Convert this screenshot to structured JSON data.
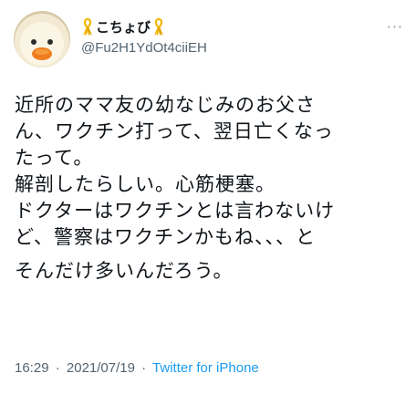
{
  "user": {
    "display_name": "こちょび",
    "handle": "@Fu2H1YdOt4ciiEH",
    "badge_icon": "yellow-ribbon-icon",
    "avatar_icon": "duck-avatar-icon"
  },
  "menu": {
    "more_label": "···"
  },
  "tweet": {
    "lines": [
      "近所のママ友の幼なじみのお父さ",
      "ん、ワクチン打って、翌日亡くなっ",
      "たって。",
      "解剖したらしい。心筋梗塞。",
      "ドクターはワクチンとは言わないけ",
      "ど、警察はワクチンかもね、、、と",
      "そんだけ多いんだろう。"
    ],
    "time": "16:29",
    "date": "2021/07/19",
    "separator": "·",
    "source": "Twitter for iPhone"
  },
  "colors": {
    "text": "#0f1419",
    "secondary": "#536471",
    "link": "#1d9bf0",
    "ribbon": "#f2b705"
  }
}
